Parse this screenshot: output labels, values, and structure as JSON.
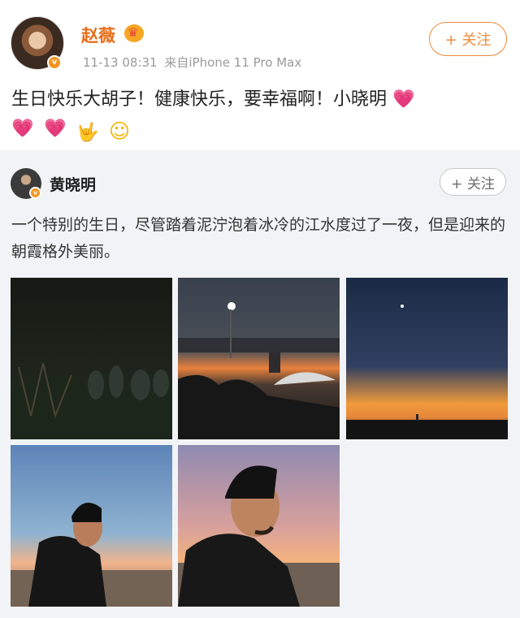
{
  "post": {
    "author": "赵薇",
    "time": "11-13 08:31",
    "source": "来自iPhone 11 Pro Max",
    "follow_label": "+ 关注",
    "text": "生日快乐大胡子！健康快乐，要幸福啊！小晓明",
    "verified_mark": "v"
  },
  "repost": {
    "author": "黄晓明",
    "follow_label": "+ 关注",
    "text": "一个特别的生日，尽管踏着泥泞泡着冰冷的江水度过了一夜，但是迎来的朝霞格外美丽。",
    "verified_mark": "v"
  },
  "photos": [
    {
      "name": "night-crowd-photo"
    },
    {
      "name": "bridge-dusk-photo"
    },
    {
      "name": "river-sunrise-photo"
    },
    {
      "name": "man-river-photo"
    },
    {
      "name": "man-profile-photo"
    }
  ],
  "colors": {
    "brand_orange": "#f08a3a",
    "name_orange": "#e86c16",
    "repost_background": "#f2f3f6"
  }
}
